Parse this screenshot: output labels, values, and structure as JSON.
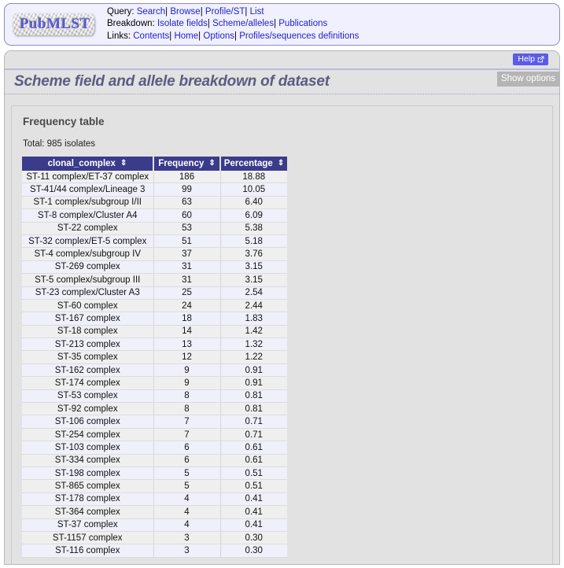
{
  "site": {
    "logo_text": "PubMLST"
  },
  "nav": {
    "rows": [
      {
        "label": "Query:",
        "links": [
          "Search",
          "Browse",
          "Profile/ST",
          "List"
        ]
      },
      {
        "label": "Breakdown:",
        "links": [
          "Isolate fields",
          "Scheme/alleles",
          "Publications"
        ]
      },
      {
        "label": "Links:",
        "links": [
          "Contents",
          "Home",
          "Options",
          "Profiles/sequences definitions"
        ]
      }
    ],
    "separator": "|"
  },
  "header": {
    "help_label": "Help",
    "help_icon": "external-link-icon",
    "page_title": "Scheme field and allele breakdown of dataset",
    "show_options_label": "Show options"
  },
  "results": {
    "heading": "Frequency table",
    "total_line": "Total: 985 isolates",
    "sort_icon": "⇕"
  },
  "table": {
    "columns": [
      "clonal_complex",
      "Frequency",
      "Percentage"
    ],
    "rows": [
      [
        "ST-11 complex/ET-37 complex",
        "186",
        "18.88"
      ],
      [
        "ST-41/44 complex/Lineage 3",
        "99",
        "10.05"
      ],
      [
        "ST-1 complex/subgroup I/II",
        "63",
        "6.40"
      ],
      [
        "ST-8 complex/Cluster A4",
        "60",
        "6.09"
      ],
      [
        "ST-22 complex",
        "53",
        "5.38"
      ],
      [
        "ST-32 complex/ET-5 complex",
        "51",
        "5.18"
      ],
      [
        "ST-4 complex/subgroup IV",
        "37",
        "3.76"
      ],
      [
        "ST-269 complex",
        "31",
        "3.15"
      ],
      [
        "ST-5 complex/subgroup III",
        "31",
        "3.15"
      ],
      [
        "ST-23 complex/Cluster A3",
        "25",
        "2.54"
      ],
      [
        "ST-60 complex",
        "24",
        "2.44"
      ],
      [
        "ST-167 complex",
        "18",
        "1.83"
      ],
      [
        "ST-18 complex",
        "14",
        "1.42"
      ],
      [
        "ST-213 complex",
        "13",
        "1.32"
      ],
      [
        "ST-35 complex",
        "12",
        "1.22"
      ],
      [
        "ST-162 complex",
        "9",
        "0.91"
      ],
      [
        "ST-174 complex",
        "9",
        "0.91"
      ],
      [
        "ST-53 complex",
        "8",
        "0.81"
      ],
      [
        "ST-92 complex",
        "8",
        "0.81"
      ],
      [
        "ST-106 complex",
        "7",
        "0.71"
      ],
      [
        "ST-254 complex",
        "7",
        "0.71"
      ],
      [
        "ST-103 complex",
        "6",
        "0.61"
      ],
      [
        "ST-334 complex",
        "6",
        "0.61"
      ],
      [
        "ST-198 complex",
        "5",
        "0.51"
      ],
      [
        "ST-865 complex",
        "5",
        "0.51"
      ],
      [
        "ST-178 complex",
        "4",
        "0.41"
      ],
      [
        "ST-364 complex",
        "4",
        "0.41"
      ],
      [
        "ST-37 complex",
        "4",
        "0.41"
      ],
      [
        "ST-1157 complex",
        "3",
        "0.30"
      ],
      [
        "ST-116 complex",
        "3",
        "0.30"
      ]
    ]
  },
  "colors": {
    "nav_link": "#2222cc",
    "nav_bg": "#f0f0ff",
    "panel_bg": "#e2e2e2",
    "table_header_bg": "#3b3b8c",
    "row_odd": "#efefef",
    "row_even": "#f0f0fb",
    "help_button_bg": "#5b5be8",
    "show_options_bg": "#b5b5b5",
    "title_color": "#5b5b82"
  }
}
